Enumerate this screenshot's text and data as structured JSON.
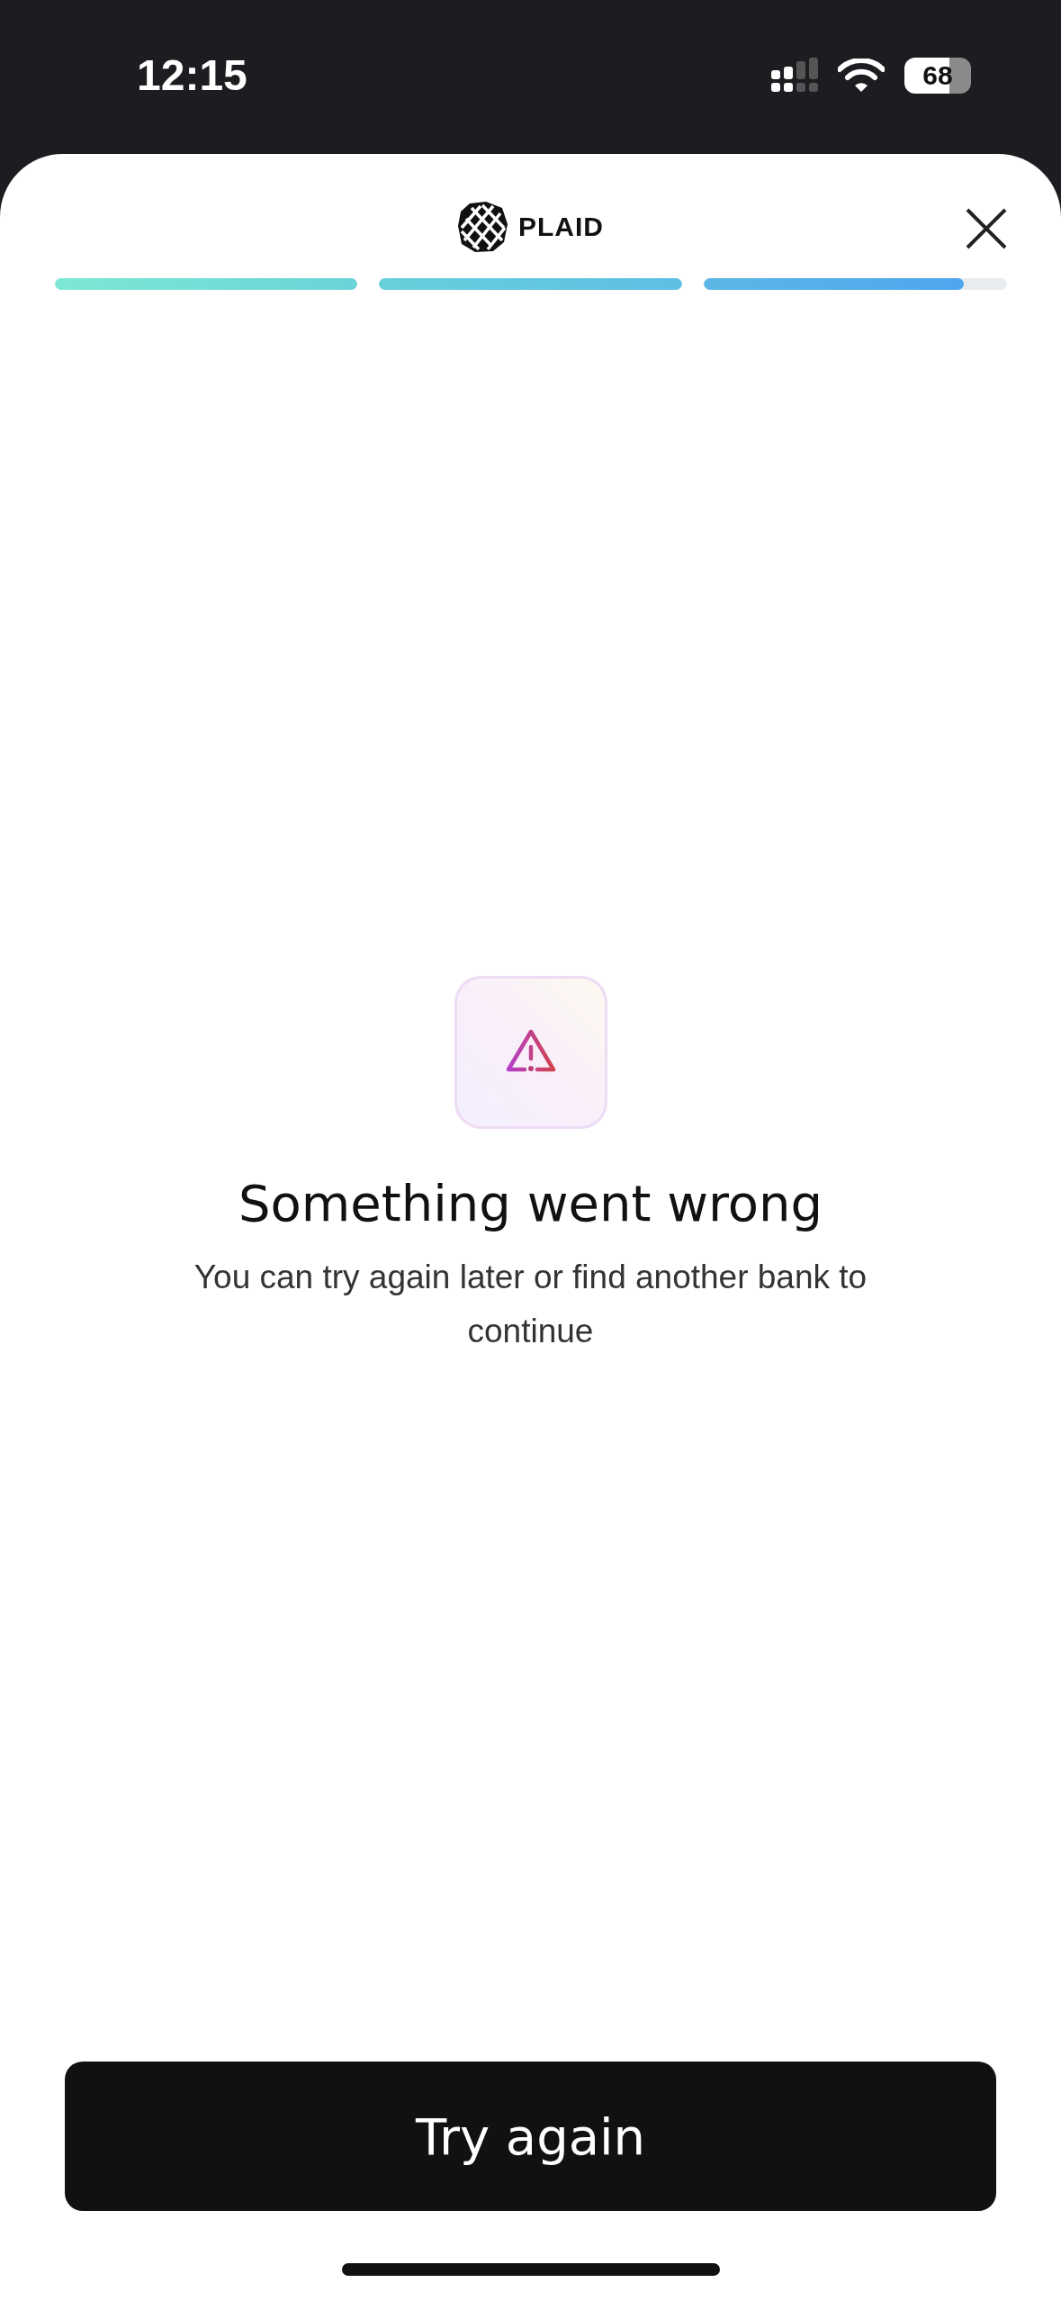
{
  "status_bar": {
    "time": "12:15",
    "battery": "68"
  },
  "header": {
    "logo": "PLAID"
  },
  "progress": [
    {
      "level": 1
    },
    {
      "level": 1
    },
    {
      "level": 0.86
    }
  ],
  "error": {
    "title": "Something went wrong",
    "message": "You can try again later or find another bank to continue"
  },
  "button": {
    "label": "Try again"
  }
}
